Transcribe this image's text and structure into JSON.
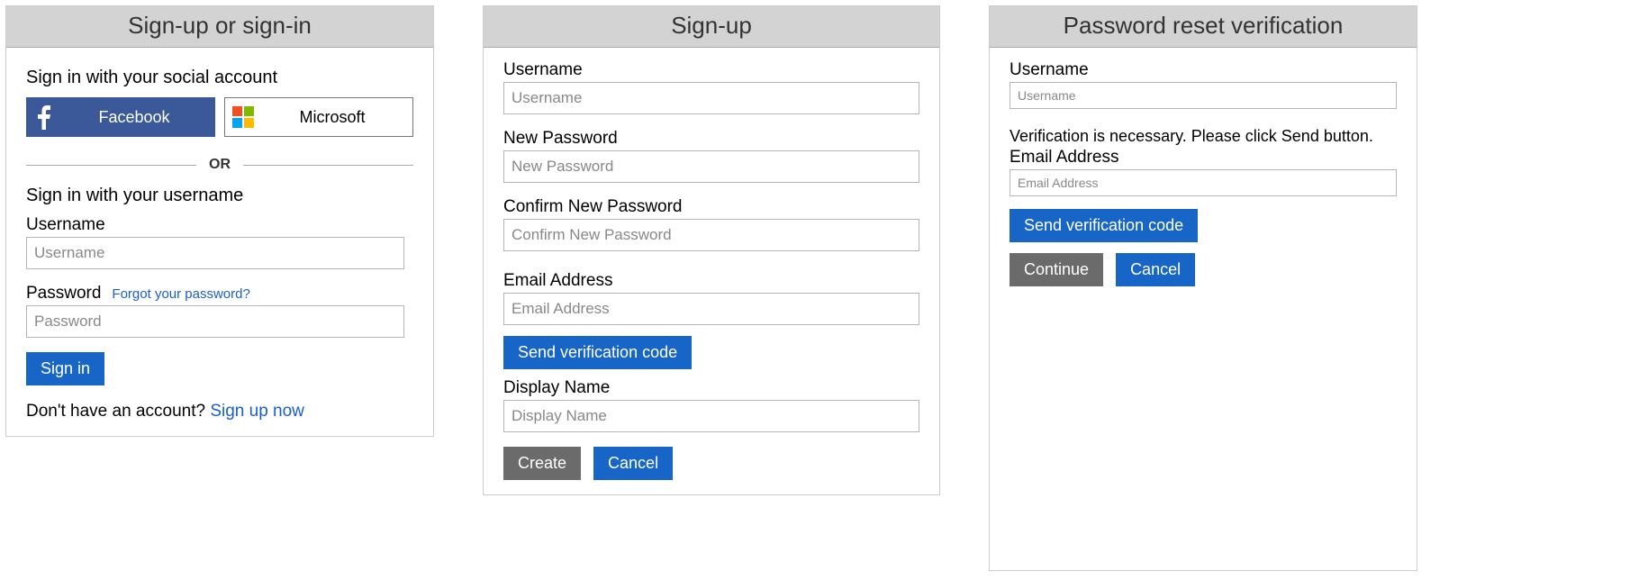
{
  "signin": {
    "title": "Sign-up or sign-in",
    "social_title": "Sign in with your social account",
    "facebook_label": "Facebook",
    "microsoft_label": "Microsoft",
    "divider": "OR",
    "username_title": "Sign in with your username",
    "username_label": "Username",
    "username_placeholder": "Username",
    "password_label": "Password",
    "password_placeholder": "Password",
    "forgot_link": "Forgot your password?",
    "signin_button": "Sign in",
    "no_account_text": "Don't have an account? ",
    "signup_link": "Sign up now"
  },
  "signup": {
    "title": "Sign-up",
    "username_label": "Username",
    "username_placeholder": "Username",
    "newpw_label": "New Password",
    "newpw_placeholder": "New Password",
    "confirmpw_label": "Confirm New Password",
    "confirmpw_placeholder": "Confirm New Password",
    "email_label": "Email Address",
    "email_placeholder": "Email Address",
    "send_code_button": "Send verification code",
    "display_label": "Display Name",
    "display_placeholder": "Display Name",
    "create_button": "Create",
    "cancel_button": "Cancel"
  },
  "reset": {
    "title": "Password reset verification",
    "username_label": "Username",
    "username_placeholder": "Username",
    "info_text": "Verification is necessary. Please click Send button.",
    "email_label": "Email Address",
    "email_placeholder": "Email Address",
    "send_code_button": "Send verification code",
    "continue_button": "Continue",
    "cancel_button": "Cancel"
  },
  "colors": {
    "primary": "#1766c7",
    "secondary": "#6b6b6b",
    "facebook": "#3b5998"
  }
}
